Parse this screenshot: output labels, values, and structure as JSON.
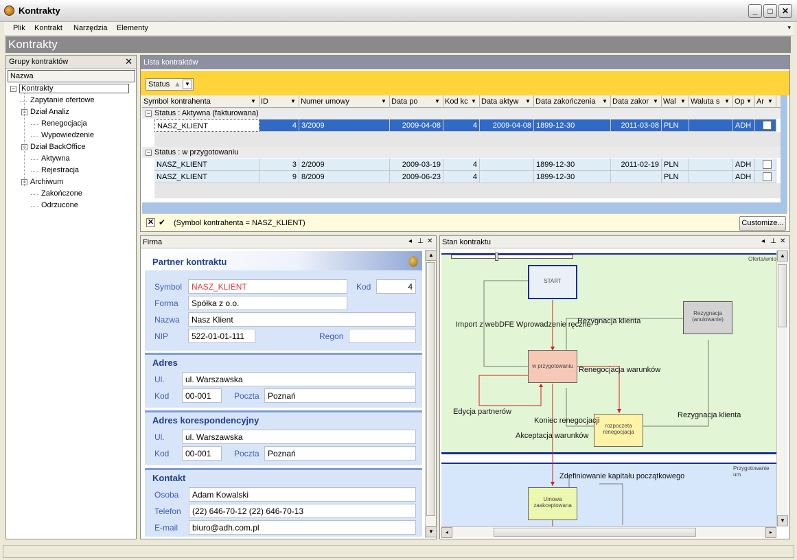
{
  "window": {
    "title": "Kontrakty",
    "buttons": {
      "minimize": "_",
      "maximize": "□",
      "close": "✕"
    }
  },
  "menu": {
    "items": [
      "Plik",
      "Kontrakt",
      "Narzędzia",
      "Elementy"
    ]
  },
  "page_title": "Kontrakty",
  "groups_panel": {
    "title": "Grupy kontraktów",
    "column": "Nazwa",
    "tree": [
      {
        "label": "Kontrakty",
        "level": 0,
        "expander": "−"
      },
      {
        "label": "Zapytanie ofertowe",
        "level": 1
      },
      {
        "label": "Dział Analiz",
        "level": 1,
        "expander": "−"
      },
      {
        "label": "Renegocjacja",
        "level": 2
      },
      {
        "label": "Wypowiedzenie",
        "level": 2
      },
      {
        "label": "Dział BackOffice",
        "level": 1,
        "expander": "−"
      },
      {
        "label": "Aktywna",
        "level": 2
      },
      {
        "label": "Rejestracja",
        "level": 2
      },
      {
        "label": "Archiwum",
        "level": 1,
        "expander": "−"
      },
      {
        "label": "Zakończone",
        "level": 2
      },
      {
        "label": "Odrzucone",
        "level": 2
      }
    ]
  },
  "contracts_list": {
    "title": "Lista kontraktów",
    "group_by": "Status",
    "columns": [
      "Symbol kontrahenta",
      "ID",
      "Numer umowy",
      "Data po",
      "Kod kc",
      "Data aktyw",
      "Data zakończenia",
      "Data zakor",
      "Wal",
      "Waluta s",
      "Op",
      "Ar"
    ],
    "groups": [
      {
        "label": "Status : Aktywna (fakturowana)",
        "rows": [
          {
            "symbol": "NASZ_KLIENT",
            "id": "4",
            "numer": "3/2009",
            "data_po": "2009-04-08",
            "kod": "4",
            "data_aktyw": "2009-04-08",
            "data_zak": "1899-12-30",
            "data_zakor": "2011-03-08",
            "wal": "PLN",
            "waluta_s": "",
            "op": "ADH",
            "selected": true
          }
        ]
      },
      {
        "label": "Status : w przygotowaniu",
        "rows": [
          {
            "symbol": "NASZ_KLIENT",
            "id": "3",
            "numer": "2/2009",
            "data_po": "2009-03-19",
            "kod": "4",
            "data_aktyw": "",
            "data_zak": "1899-12-30",
            "data_zakor": "2011-02-19",
            "wal": "PLN",
            "waluta_s": "",
            "op": "ADH",
            "selected": false
          },
          {
            "symbol": "NASZ_KLIENT",
            "id": "9",
            "numer": "8/2009",
            "data_po": "2009-06-23",
            "kod": "4",
            "data_aktyw": "",
            "data_zak": "1899-12-30",
            "data_zakor": "",
            "wal": "PLN",
            "waluta_s": "",
            "op": "ADH",
            "selected": false
          }
        ]
      }
    ],
    "filter": {
      "text": "(Symbol kontrahenta = NASZ_KLIENT)",
      "customize": "Customize..."
    }
  },
  "firma_panel": {
    "title": "Firma",
    "partner": {
      "title": "Partner kontraktu",
      "symbol_label": "Symbol",
      "symbol": "NASZ_KLIENT",
      "kod_label": "Kod",
      "kod": "4",
      "forma_label": "Forma",
      "forma": "Spółka z o.o.",
      "nazwa_label": "Nazwa",
      "nazwa": "Nasz Klient",
      "nip_label": "NIP",
      "nip": "522-01-01-111",
      "regon_label": "Regon",
      "regon": ""
    },
    "adres": {
      "title": "Adres",
      "ul_label": "Ul.",
      "ul": "ul. Warszawska",
      "kod_label": "Kod",
      "kod": "00-001",
      "poczta_label": "Poczta",
      "poczta": "Poznań"
    },
    "adres_kor": {
      "title": "Adres korespondencyjny",
      "ul_label": "Ul.",
      "ul": "ul. Warszawska",
      "kod_label": "Kod",
      "kod": "00-001",
      "poczta_label": "Poczta",
      "poczta": "Poznań"
    },
    "kontakt": {
      "title": "Kontakt",
      "osoba_label": "Osoba",
      "osoba": "Adam Kowalski",
      "telefon_label": "Telefon",
      "telefon": "(22) 646-70-12  (22) 646-70-13",
      "email_label": "E-mail",
      "email": "biuro@adh.com.pl"
    }
  },
  "stan_panel": {
    "title": "Stan kontraktu",
    "lanes": [
      "Oferta/wnio",
      "Przygotowanie um"
    ],
    "states": [
      "START",
      "Rezygnacja (anulowanie)",
      "w przygotowaniu",
      "rozpoczeta renegocjacja",
      "Umowa zaakceptowana"
    ],
    "transitions": [
      "Import z webDFE",
      "Wprowadzenie ręczne",
      "Rezygnacja klienta",
      "Renegocjacja warunków",
      "Edycja partnerów",
      "Koniec renegocjacji",
      "Akceptacja warunków",
      "Rezygnacja klienta",
      "Zdefiniowanie kapitału początkowego"
    ]
  },
  "colors": {
    "accent_yellow": "#ffd33a",
    "selection": "#316ac5",
    "section_blue": "#d8e4f8",
    "lane_green": "#e2f5d4",
    "lane_blue": "#d6e6fb"
  },
  "icons": [
    "app-icon",
    "close-icon",
    "pin-icon",
    "arrow-left-icon",
    "dropdown-icon",
    "checkbox-icon",
    "scroll-up-icon",
    "scroll-down-icon"
  ]
}
